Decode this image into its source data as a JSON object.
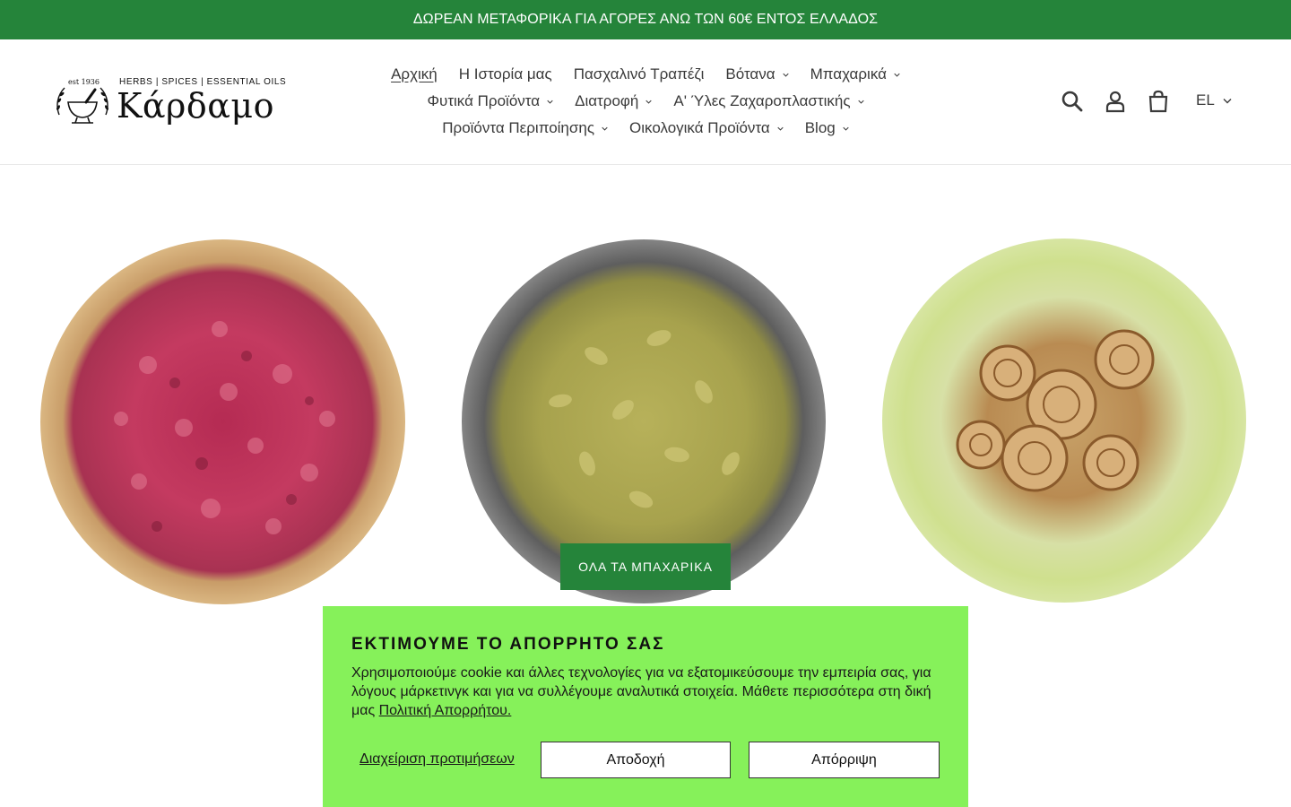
{
  "announcement": "ΔΩΡΕΑΝ ΜΕΤΑΦΟΡΙΚΑ ΓΙΑ ΑΓΟΡΕΣ ΑΝΩ ΤΩΝ 60€ ΕΝΤΟΣ ΕΛΛΑΔΟΣ",
  "logo": {
    "tagline": "HERBS | SPICES | ESSENTIAL OILS",
    "name": "Κάρδαμο",
    "est": "est 1936"
  },
  "nav": {
    "row1": [
      "Αρχική",
      "Η Ιστορία μας",
      "Πασχαλινό Τραπέζι",
      "Βότανα",
      "Μπαχαρικά"
    ],
    "row2": [
      "Φυτικά Προϊόντα",
      "Διατροφή",
      "Α' Ύλες Ζαχαροπλαστικής"
    ],
    "row3": [
      "Προϊόντα Περιποίησης",
      "Οικολογικά Προϊόντα",
      "Blog"
    ]
  },
  "header_icons": [
    "search-icon",
    "account-icon",
    "cart-icon"
  ],
  "language": "EL",
  "hero": {
    "cta_label": "ΟΛΑ ΤΑ ΜΠΑΧΑΡΙΚΑ",
    "images": [
      "dried-rose-buds",
      "green-cardamom-pods",
      "cinnamon-sticks"
    ]
  },
  "cookie": {
    "title": "ΕΚΤΙΜΟΥΜΕ ΤΟ ΑΠΟΡΡΗΤΟ ΣΑΣ",
    "text": "Χρησιμοποιούμε cookie και άλλες τεχνολογίες για να εξατομικεύσουμε την εμπειρία σας, για λόγους μάρκετινγκ και για να συλλέγουμε αναλυτικά στοιχεία. Μάθετε περισσότερα στη δική μας ",
    "policy_link": "Πολιτική Απορρήτου.",
    "manage_label": "Διαχείριση προτιμήσεων",
    "accept_label": "Αποδοχή",
    "reject_label": "Απόρριψη"
  },
  "colors": {
    "brand_green": "#25843a",
    "cookie_bg": "#86f15a"
  }
}
